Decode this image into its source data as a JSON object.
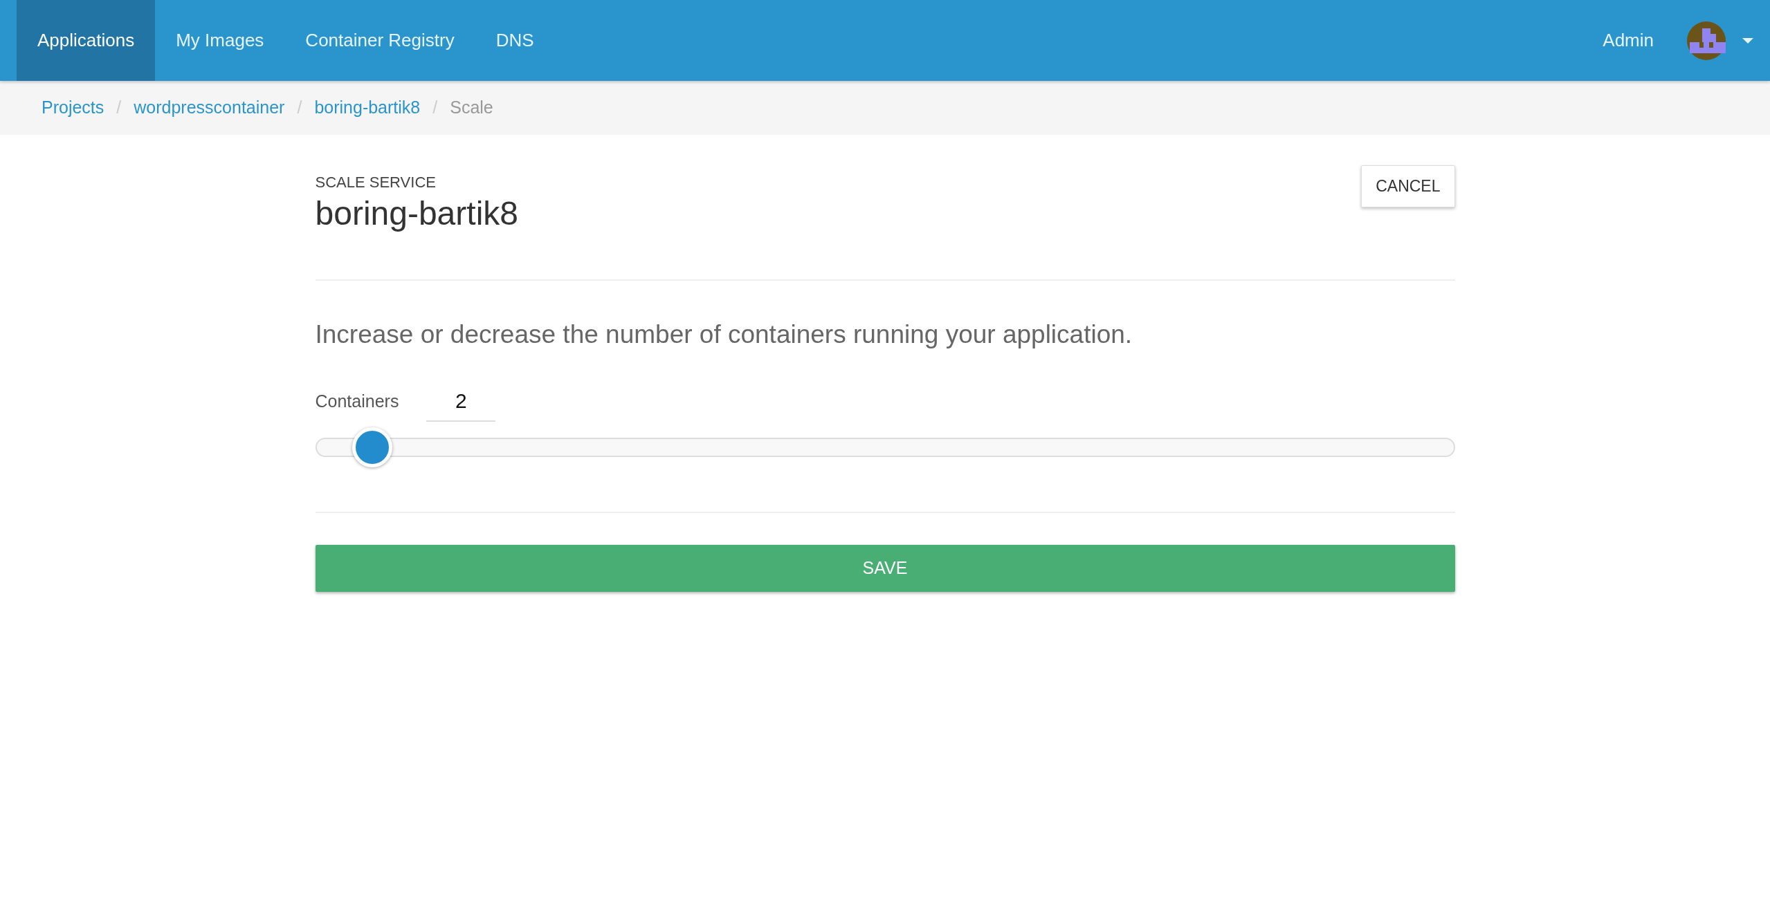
{
  "navbar": {
    "tabs": [
      {
        "label": "Applications",
        "selected": true
      },
      {
        "label": "My Images",
        "selected": false
      },
      {
        "label": "Container Registry",
        "selected": false
      },
      {
        "label": "DNS",
        "selected": false
      }
    ],
    "user": "Admin"
  },
  "breadcrumb": [
    {
      "kind": "link",
      "label": "Projects",
      "current": false
    },
    {
      "kind": "separator",
      "label": "/"
    },
    {
      "kind": "link",
      "label": "wordpresscontainer",
      "current": false
    },
    {
      "kind": "separator",
      "label": "/"
    },
    {
      "kind": "link",
      "label": "boring-bartik8",
      "current": false
    },
    {
      "kind": "separator",
      "label": "/"
    },
    {
      "kind": "link",
      "label": "Scale",
      "current": true
    }
  ],
  "header": {
    "eyebrow": "SCALE SERVICE",
    "title": "boring-bartik8",
    "cancel": "CANCEL"
  },
  "description": "Increase or decrease the number of containers running your application.",
  "containers": {
    "label": "Containers",
    "value": "2",
    "level": 0.05
  },
  "save": "SAVE"
}
